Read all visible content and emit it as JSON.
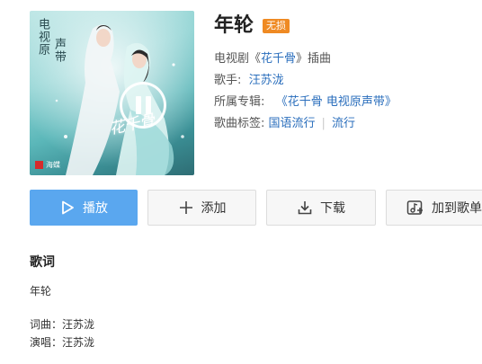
{
  "cover": {
    "vertical_title_1": "电视原",
    "vertical_title_2": "声带",
    "calligraphy": "花千骨",
    "brand": "海蝶",
    "pause_icon": "pause-circle-icon"
  },
  "song": {
    "title": "年轮",
    "badge": "无损",
    "source_prefix": "电视剧《",
    "source_name": "花千骨",
    "source_suffix": "》插曲",
    "singer_label": "歌手:",
    "singer": "汪苏泷",
    "album_label": "所属专辑:",
    "album": "《花千骨 电视原声带》",
    "tags_label": "歌曲标签:",
    "tags": [
      "国语流行",
      "流行"
    ]
  },
  "actions": {
    "play": "播放",
    "add": "添加",
    "download": "下载",
    "add_to_playlist": "加到歌单"
  },
  "lyrics": {
    "heading": "歌词",
    "title_line": "年轮",
    "lyricist": "词曲：汪苏泷",
    "singer": "演唱：汪苏泷"
  },
  "colors": {
    "primary": "#5aa7ef",
    "link": "#2a6ebc",
    "badge": "#ef8a23"
  }
}
